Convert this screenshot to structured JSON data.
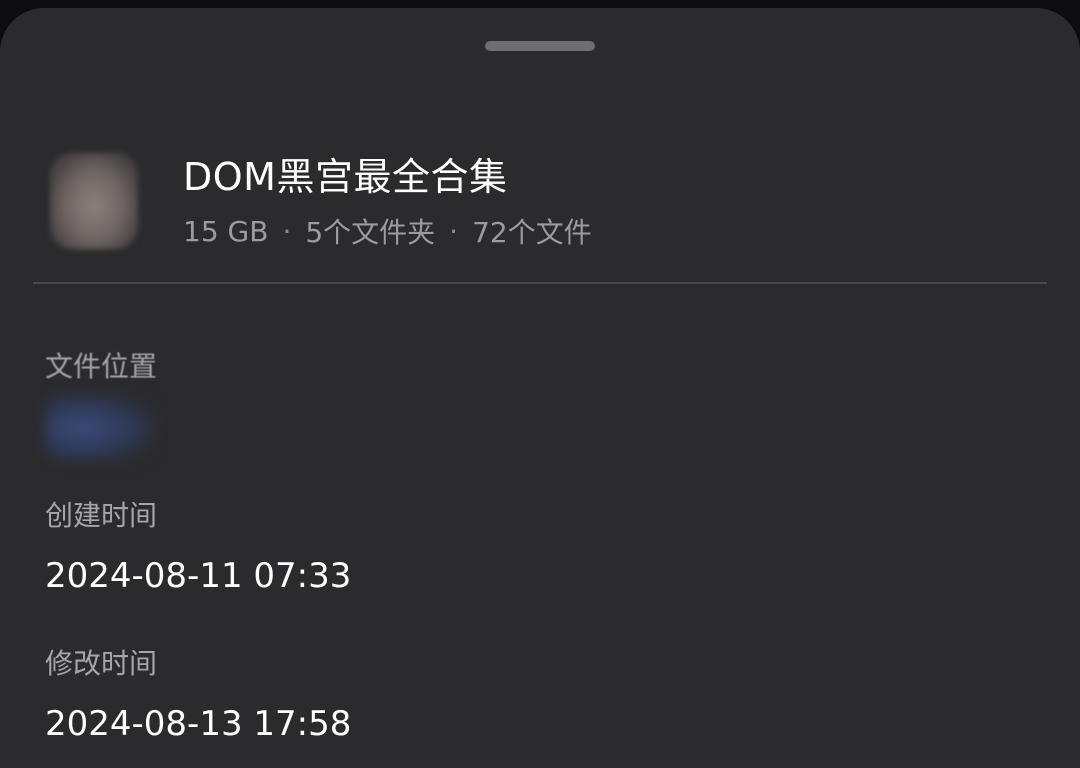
{
  "file": {
    "name": "DOM黑宫最全合集",
    "size": "15 GB",
    "separator": "·",
    "folders": "5个文件夹",
    "files": "72个文件"
  },
  "details": {
    "location_label": "文件位置",
    "created_label": "创建时间",
    "created_value": "2024-08-11 07:33",
    "modified_label": "修改时间",
    "modified_value": "2024-08-13 17:58"
  },
  "colors": {
    "sheet_background": "#2b2b2d",
    "primary_text": "#ffffff",
    "secondary_text": "#9c9ca0"
  },
  "icons": {
    "thumbnail": "blurred-folder-thumbnail",
    "drag_handle": "drag-handle"
  }
}
